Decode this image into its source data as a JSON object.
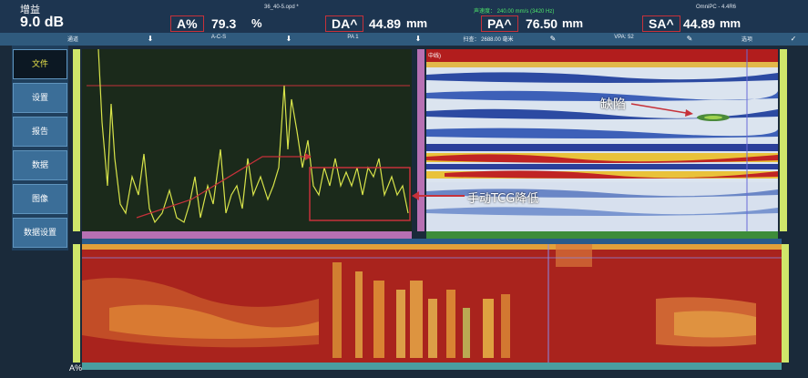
{
  "header": {
    "gain_label": "增益",
    "gain_value": "9.0  dB",
    "file_name": "36_40-5.opd *",
    "velocity_info": "声速度：  240.00 mm/s  (3420 Hz)",
    "version": "OmniPC - 4.4R6",
    "measurements": [
      {
        "key": "A%",
        "value": "79.3",
        "unit": "%"
      },
      {
        "key": "DA^",
        "value": "44.89",
        "unit": "mm"
      },
      {
        "key": "PA^",
        "value": "76.50",
        "unit": "mm"
      },
      {
        "key": "SA^",
        "value": "44.89",
        "unit": "mm"
      }
    ]
  },
  "tabs": [
    {
      "label": "通道"
    },
    {
      "label": "A-C-S"
    },
    {
      "label": "PA 1"
    },
    {
      "label": "扫查：  2688.00 毫米"
    },
    {
      "label": "VPA:  52"
    },
    {
      "label": "选项"
    }
  ],
  "sidebar": {
    "items": [
      {
        "label": "文件"
      },
      {
        "label": "设置"
      },
      {
        "label": "报告"
      },
      {
        "label": "数据"
      },
      {
        "label": "图像"
      },
      {
        "label": "数据设置"
      }
    ]
  },
  "bscan_header": "中线)",
  "annotations": {
    "defect": "缺陷",
    "tcg": "手动TCG降低"
  },
  "footer": {
    "amp_label": "A%"
  },
  "colors": {
    "accent": "#c6313a",
    "trace": "#d8e44a",
    "header_bg": "#1d3550",
    "sidebar_btn": "#3b6e98"
  }
}
